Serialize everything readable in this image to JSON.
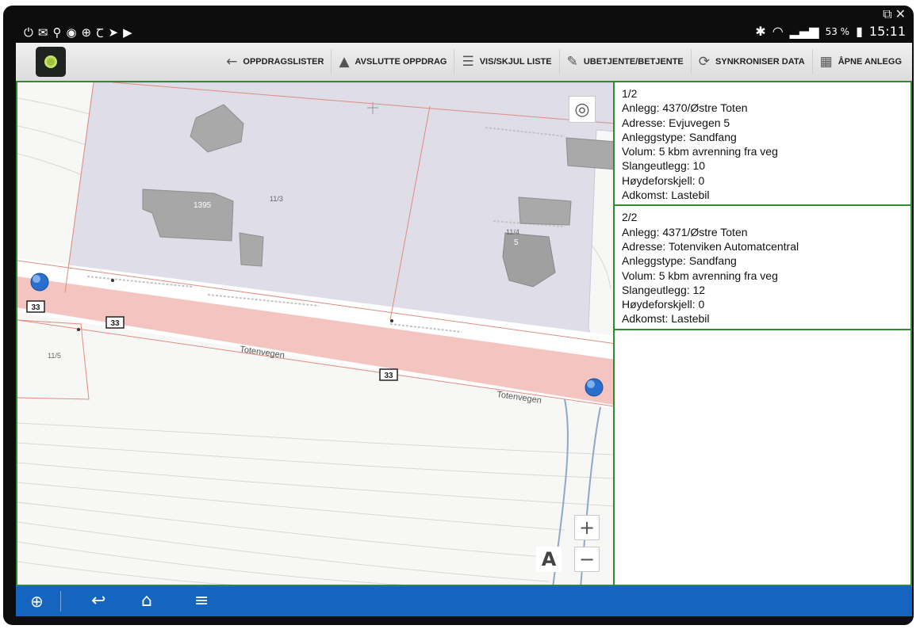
{
  "status_bar": {
    "left_icons": [
      "power-icon",
      "mail-icon",
      "location-icon",
      "eye-icon",
      "teamviewer-icon",
      "nytimes-icon",
      "send-icon",
      "play-icon"
    ],
    "battery_percent": "53 %",
    "time": "15:11"
  },
  "toolbar": {
    "actions": [
      {
        "label": "OPPDRAGSLISTER",
        "icon": "←"
      },
      {
        "label": "AVSLUTTE OPPDRAG",
        "icon": "▲"
      },
      {
        "label": "VIS/SKJUL LISTE",
        "icon": "☰"
      },
      {
        "label": "UBETJENTE/BETJENTE",
        "icon": "✎"
      },
      {
        "label": "SYNKRONISER DATA",
        "icon": "⟳"
      },
      {
        "label": "ÅPNE ANLEGG",
        "icon": "▦"
      }
    ]
  },
  "map": {
    "labels": {
      "road_shield_1": "33",
      "road_shield_2": "33",
      "road_shield_3": "33",
      "road_name_1": "Totenvegen",
      "road_name_2": "Totenvegen",
      "house_number": "1395",
      "house_number_2": "5",
      "parcel_1": "11/3",
      "parcel_2": "11/4",
      "parcel_3": "11/5"
    },
    "controls": {
      "locate": "◎",
      "zoom_in": "+",
      "zoom_out": "−",
      "label_toggle": "A"
    },
    "colors": {
      "road": "#f4c5c0",
      "plot": "#dedde8",
      "building": "#a7a7a7",
      "water": "#8fb8e0",
      "marker": "#2a6fce"
    }
  },
  "list": {
    "items": [
      {
        "counter": "1/2",
        "anlegg": "Anlegg: 4370/Østre Toten",
        "adresse": "Adresse: Evjuvegen 5",
        "type": "Anleggstype: Sandfang",
        "volum": "Volum: 5 kbm avrenning fra veg",
        "slange": "Slangeutlegg: 10",
        "hoyde": "Høydeforskjell: 0",
        "adkomst": "Adkomst: Lastebil"
      },
      {
        "counter": "2/2",
        "anlegg": "Anlegg: 4371/Østre Toten",
        "adresse": "Adresse: Totenviken Automatcentral",
        "type": "Anleggstype: Sandfang",
        "volum": "Volum: 5 kbm avrenning fra veg",
        "slange": "Slangeutlegg: 12",
        "hoyde": "Høydeforskjell: 0",
        "adkomst": "Adkomst: Lastebil"
      }
    ]
  },
  "nav": {
    "teamviewer": "⊕",
    "back": "↩",
    "home": "⌂",
    "recents": "≡"
  },
  "colors": {
    "accent_green": "#2e8b2e",
    "nav_blue": "#1565c0"
  }
}
